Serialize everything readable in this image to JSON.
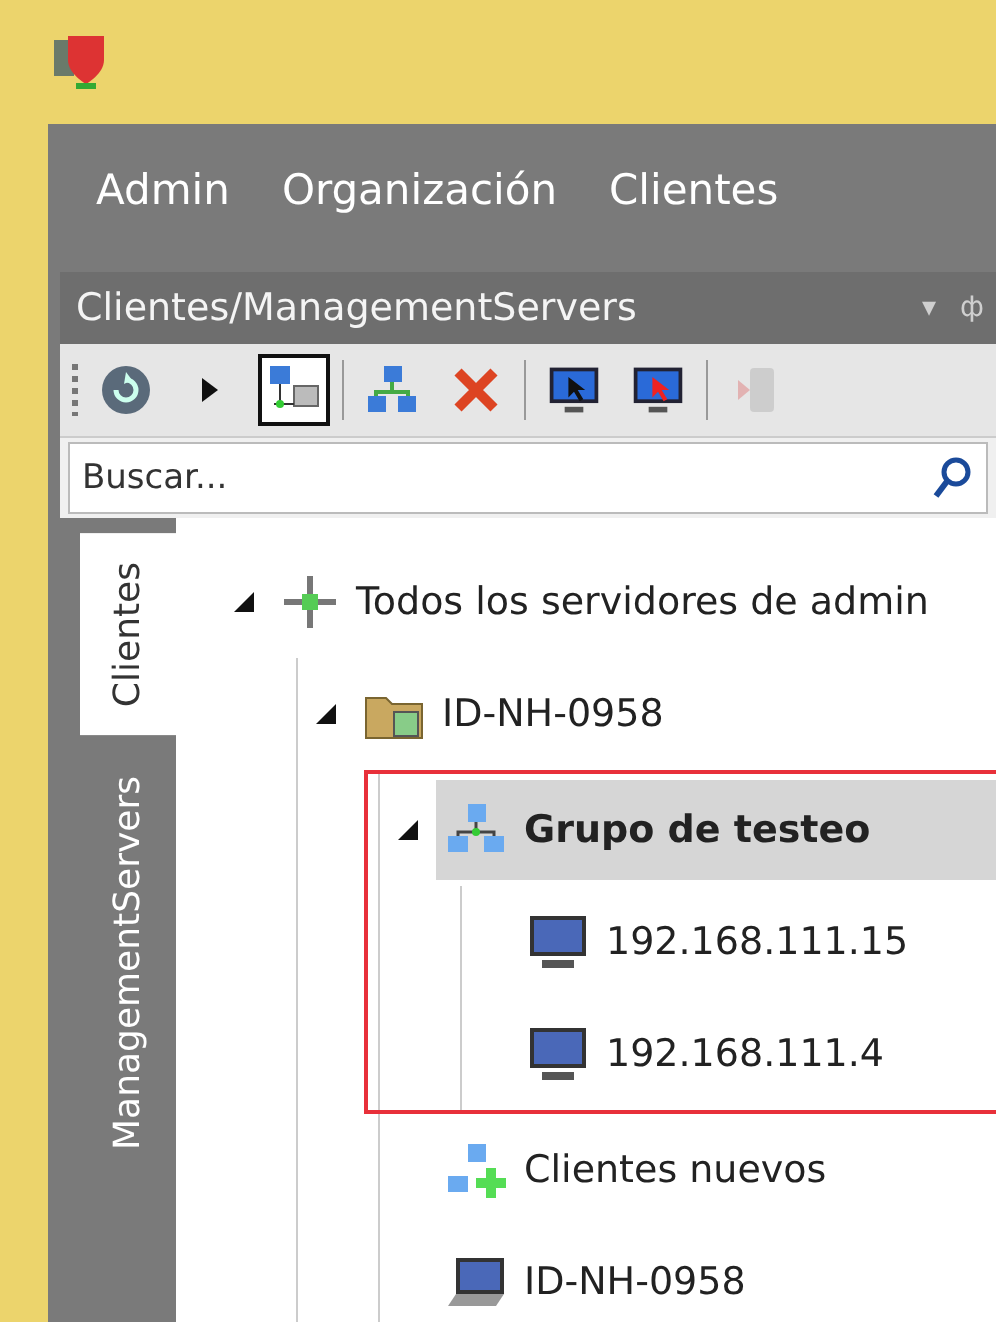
{
  "menu": [
    {
      "label": "Admin"
    },
    {
      "label": "Organización"
    },
    {
      "label": "Clientes"
    }
  ],
  "panel": {
    "title": "Clientes/ManagementServers",
    "dropdown": "▾",
    "pin": "ф"
  },
  "toolbar": [
    {
      "kind": "refresh",
      "pressed": false,
      "disabled": false
    },
    {
      "kind": "play",
      "pressed": false,
      "disabled": false
    },
    {
      "kind": "network",
      "pressed": true,
      "disabled": false
    },
    {
      "kind": "group",
      "pressed": false,
      "disabled": false
    },
    {
      "kind": "delete",
      "pressed": false,
      "disabled": false
    },
    {
      "kind": "remote",
      "pressed": false,
      "disabled": false
    },
    {
      "kind": "remote-alert",
      "pressed": false,
      "disabled": false
    },
    {
      "kind": "phone",
      "pressed": false,
      "disabled": true
    }
  ],
  "search": {
    "placeholder": "Buscar..."
  },
  "side_tabs": [
    {
      "label": "Clientes",
      "selected": true
    },
    {
      "label": "ManagementServers",
      "selected": false
    }
  ],
  "tree": [
    {
      "kind": "servers",
      "label": "Todos los servidores de admin",
      "expanded": true,
      "selected": false,
      "outlined": false,
      "children": [
        {
          "kind": "folder",
          "label": "ID-NH-0958",
          "expanded": true,
          "selected": false,
          "outlined": false,
          "children": [
            {
              "kind": "group",
              "label": "Grupo de testeo",
              "expanded": true,
              "selected": true,
              "outlined": true,
              "children": [
                {
                  "kind": "computer",
                  "label": "192.168.111.15",
                  "expanded": false,
                  "selected": false,
                  "outlined": false
                },
                {
                  "kind": "computer",
                  "label": "192.168.111.4",
                  "expanded": false,
                  "selected": false,
                  "outlined": false
                }
              ]
            },
            {
              "kind": "new-group",
              "label": "Clientes nuevos",
              "expanded": false,
              "selected": false,
              "outlined": false
            },
            {
              "kind": "laptop",
              "label": "ID-NH-0958",
              "expanded": false,
              "selected": false,
              "outlined": false
            }
          ]
        }
      ]
    }
  ]
}
